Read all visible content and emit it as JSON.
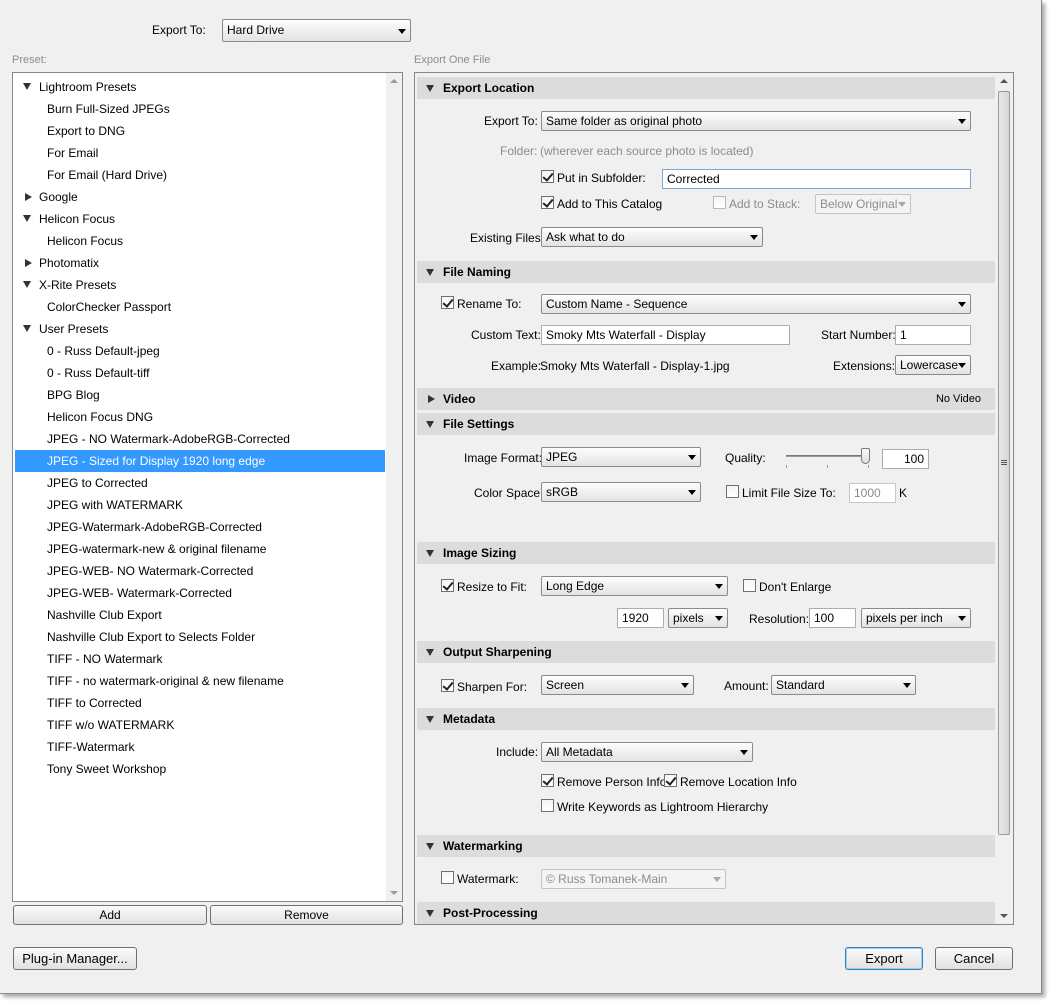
{
  "header": {
    "export_to_label": "Export To:",
    "export_to_value": "Hard Drive"
  },
  "preset": {
    "label": "Preset:",
    "items": [
      {
        "label": "Lightroom Presets",
        "kind": "folder-open"
      },
      {
        "label": "Burn Full-Sized JPEGs",
        "kind": "item"
      },
      {
        "label": "Export to DNG",
        "kind": "item"
      },
      {
        "label": "For Email",
        "kind": "item"
      },
      {
        "label": "For Email (Hard Drive)",
        "kind": "item"
      },
      {
        "label": "Google",
        "kind": "folder-closed"
      },
      {
        "label": "Helicon Focus",
        "kind": "folder-open"
      },
      {
        "label": "Helicon Focus",
        "kind": "item"
      },
      {
        "label": "Photomatix",
        "kind": "folder-closed"
      },
      {
        "label": "X-Rite Presets",
        "kind": "folder-open"
      },
      {
        "label": "ColorChecker Passport",
        "kind": "item"
      },
      {
        "label": "User Presets",
        "kind": "folder-open"
      },
      {
        "label": "0 - Russ Default-jpeg",
        "kind": "item"
      },
      {
        "label": "0 - Russ Default-tiff",
        "kind": "item"
      },
      {
        "label": "BPG Blog",
        "kind": "item"
      },
      {
        "label": "Helicon Focus DNG",
        "kind": "item"
      },
      {
        "label": "JPEG - NO Watermark-AdobeRGB-Corrected",
        "kind": "item"
      },
      {
        "label": "JPEG - Sized for Display 1920 long edge",
        "kind": "item",
        "selected": true
      },
      {
        "label": "JPEG to Corrected",
        "kind": "item"
      },
      {
        "label": "JPEG with WATERMARK",
        "kind": "item"
      },
      {
        "label": "JPEG-Watermark-AdobeRGB-Corrected",
        "kind": "item"
      },
      {
        "label": "JPEG-watermark-new & original filename",
        "kind": "item"
      },
      {
        "label": "JPEG-WEB- NO Watermark-Corrected",
        "kind": "item"
      },
      {
        "label": "JPEG-WEB- Watermark-Corrected",
        "kind": "item"
      },
      {
        "label": "Nashville Club Export",
        "kind": "item"
      },
      {
        "label": "Nashville Club Export to Selects Folder",
        "kind": "item"
      },
      {
        "label": "TIFF - NO Watermark",
        "kind": "item"
      },
      {
        "label": "TIFF - no watermark-original & new filename",
        "kind": "item"
      },
      {
        "label": "TIFF to Corrected",
        "kind": "item"
      },
      {
        "label": "TIFF w/o WATERMARK",
        "kind": "item"
      },
      {
        "label": "TIFF-Watermark",
        "kind": "item"
      },
      {
        "label": "Tony Sweet Workshop",
        "kind": "item"
      }
    ],
    "add_button": "Add",
    "remove_button": "Remove"
  },
  "right_title": "Export One File",
  "export_location": {
    "title": "Export Location",
    "export_to_label": "Export To:",
    "export_to_value": "Same folder as original photo",
    "folder_label": "Folder:",
    "folder_value": "(wherever each source photo is located)",
    "put_in_subfolder_label": "Put in Subfolder:",
    "put_in_subfolder_checked": true,
    "subfolder_value": "Corrected",
    "add_to_catalog_label": "Add to This Catalog",
    "add_to_catalog_checked": true,
    "add_to_stack_label": "Add to Stack:",
    "add_to_stack_checked": false,
    "stack_position_value": "Below Original",
    "existing_files_label": "Existing Files:",
    "existing_files_value": "Ask what to do"
  },
  "file_naming": {
    "title": "File Naming",
    "rename_to_label": "Rename To:",
    "rename_to_checked": true,
    "rename_to_value": "Custom Name - Sequence",
    "custom_text_label": "Custom Text:",
    "custom_text_value": "Smoky Mts Waterfall - Display",
    "start_number_label": "Start Number:",
    "start_number_value": "1",
    "example_label": "Example:",
    "example_value": "Smoky Mts Waterfall - Display-1.jpg",
    "extensions_label": "Extensions:",
    "extensions_value": "Lowercase"
  },
  "video": {
    "title": "Video",
    "status": "No Video"
  },
  "file_settings": {
    "title": "File Settings",
    "image_format_label": "Image Format:",
    "image_format_value": "JPEG",
    "quality_label": "Quality:",
    "quality_value": "100",
    "quality_level": 100,
    "color_space_label": "Color Space:",
    "color_space_value": "sRGB",
    "limit_file_size_label": "Limit File Size To:",
    "limit_file_size_checked": false,
    "limit_file_size_value": "1000",
    "limit_file_size_unit": "K"
  },
  "image_sizing": {
    "title": "Image Sizing",
    "resize_to_fit_label": "Resize to Fit:",
    "resize_to_fit_checked": true,
    "resize_to_fit_value": "Long Edge",
    "dont_enlarge_label": "Don't Enlarge",
    "dont_enlarge_checked": false,
    "size_value": "1920",
    "size_unit": "pixels",
    "resolution_label": "Resolution:",
    "resolution_value": "100",
    "resolution_unit": "pixels per inch"
  },
  "output_sharpening": {
    "title": "Output Sharpening",
    "sharpen_for_label": "Sharpen For:",
    "sharpen_for_checked": true,
    "sharpen_for_value": "Screen",
    "amount_label": "Amount:",
    "amount_value": "Standard"
  },
  "metadata": {
    "title": "Metadata",
    "include_label": "Include:",
    "include_value": "All Metadata",
    "remove_person_label": "Remove Person Info",
    "remove_person_checked": true,
    "remove_location_label": "Remove Location Info",
    "remove_location_checked": true,
    "write_keywords_label": "Write Keywords as Lightroom Hierarchy",
    "write_keywords_checked": false
  },
  "watermarking": {
    "title": "Watermarking",
    "watermark_label": "Watermark:",
    "watermark_checked": false,
    "watermark_value": "© Russ Tomanek-Main"
  },
  "post_processing": {
    "title": "Post-Processing"
  },
  "footer": {
    "plugin_manager": "Plug-in Manager...",
    "export": "Export",
    "cancel": "Cancel"
  }
}
